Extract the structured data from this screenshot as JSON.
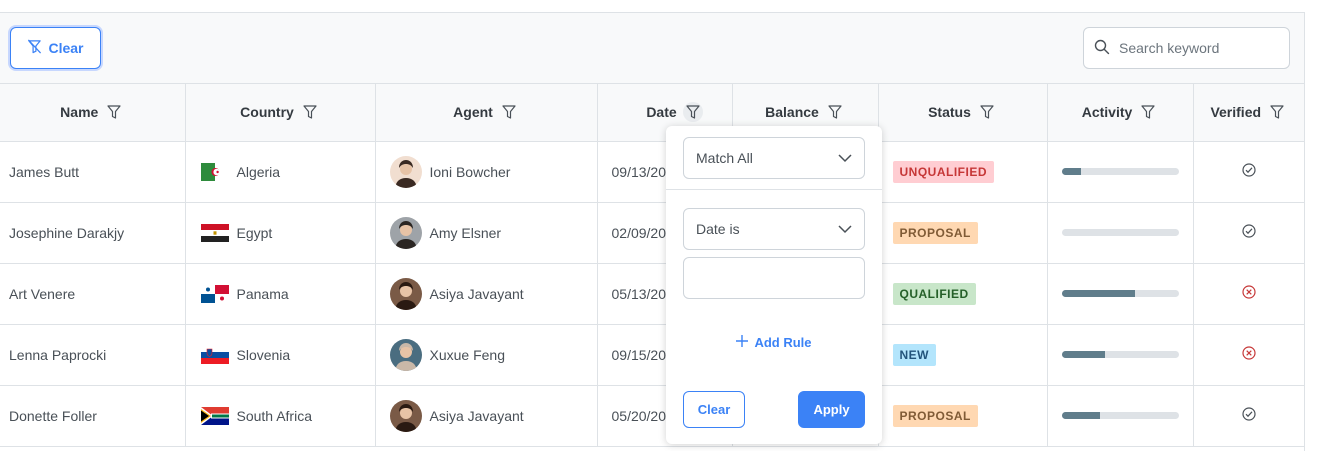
{
  "toolbar": {
    "clear_label": "Clear",
    "search_placeholder": "Search keyword"
  },
  "columns": {
    "name": "Name",
    "country": "Country",
    "agent": "Agent",
    "date": "Date",
    "balance": "Balance",
    "status": "Status",
    "activity": "Activity",
    "verified": "Verified"
  },
  "rows": [
    {
      "name": "James Butt",
      "country": "Algeria",
      "flag": "algeria-flag",
      "agent": "Ioni Bowcher",
      "date": "09/13/20",
      "status": "UNQUALIFIED",
      "status_kind": "unqualified",
      "activity": 0.17,
      "verified": true
    },
    {
      "name": "Josephine Darakjy",
      "country": "Egypt",
      "flag": "egypt-flag",
      "agent": "Amy Elsner",
      "date": "02/09/20",
      "status": "PROPOSAL",
      "status_kind": "proposal",
      "activity": 0.0,
      "verified": true
    },
    {
      "name": "Art Venere",
      "country": "Panama",
      "flag": "panama-flag",
      "agent": "Asiya Javayant",
      "date": "05/13/20",
      "status": "QUALIFIED",
      "status_kind": "qualified",
      "activity": 0.63,
      "verified": false
    },
    {
      "name": "Lenna Paprocki",
      "country": "Slovenia",
      "flag": "slovenia-flag",
      "agent": "Xuxue Feng",
      "date": "09/15/20",
      "status": "NEW",
      "status_kind": "new",
      "activity": 0.37,
      "verified": false
    },
    {
      "name": "Donette Foller",
      "country": "South Africa",
      "flag": "south-africa-flag",
      "agent": "Asiya Javayant",
      "date": "05/20/20",
      "status": "PROPOSAL",
      "status_kind": "proposal",
      "activity": 0.33,
      "verified": true
    }
  ],
  "filter_overlay": {
    "operator_value": "Match All",
    "match_mode_value": "Date is",
    "date_value": "",
    "add_rule_label": "Add Rule",
    "clear_label": "Clear",
    "apply_label": "Apply"
  },
  "colors": {
    "accent": "#3b82f6",
    "verified_ok": "#495057",
    "verified_no": "#c63737",
    "progress_fill": "#607d8b"
  }
}
